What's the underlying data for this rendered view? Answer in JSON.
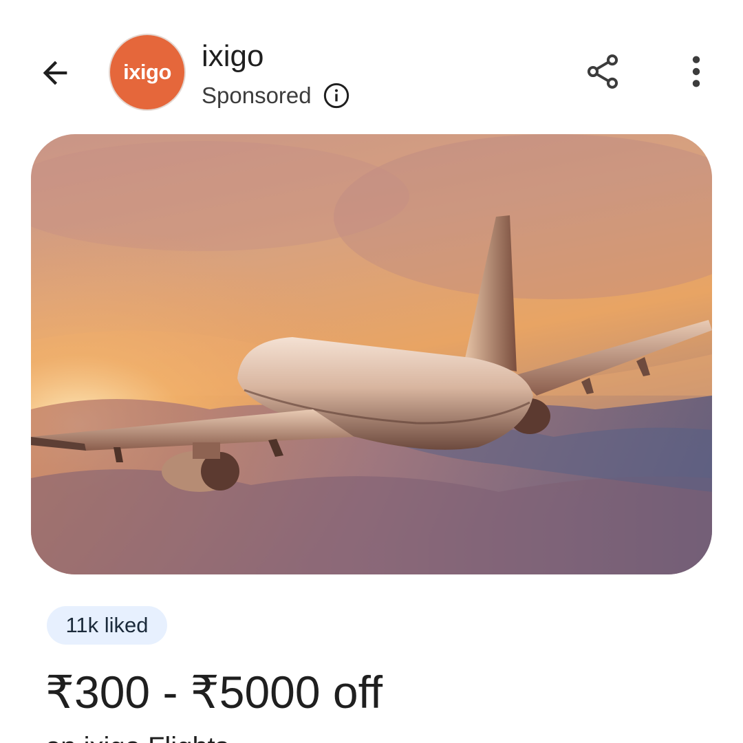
{
  "header": {
    "back_icon": "arrow-left-icon",
    "brand_logo_text": "ixigo",
    "brand_color": "#e5673b",
    "title": "ixigo",
    "sponsored_label": "Sponsored",
    "info_icon": "info-icon",
    "share_icon": "share-icon",
    "more_icon": "more-vert-icon"
  },
  "hero": {
    "icon": "airplane-image"
  },
  "stats": {
    "liked_label": "11k liked"
  },
  "offer": {
    "headline": "₹300 - ₹5000 off",
    "subtitle": "on ixigo Flights"
  },
  "colors": {
    "chip_bg": "#e7f0fe",
    "text": "#1f1f1f"
  }
}
